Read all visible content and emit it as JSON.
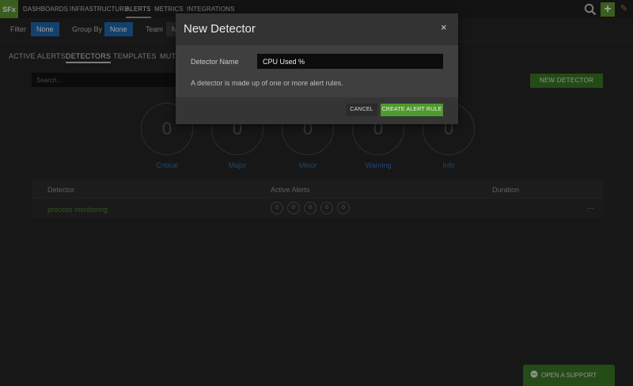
{
  "nav": {
    "logo": "SFx",
    "items": [
      {
        "label": "DASHBOARDS"
      },
      {
        "label": "INFRASTRUCTURE"
      },
      {
        "label": "ALERTS"
      },
      {
        "label": "METRICS"
      },
      {
        "label": "INTEGRATIONS"
      }
    ],
    "active": "ALERTS",
    "search_icon": "search-icon",
    "add_icon": "plus-icon",
    "user_icon": "user-icon"
  },
  "filters": {
    "filter_label": "Filter",
    "filter_value": "None",
    "group_by_label": "Group By",
    "group_by_value": "None",
    "team_label": "Team",
    "team_value": "N"
  },
  "tabs": [
    {
      "label": "ACTIVE ALERTS"
    },
    {
      "label": "DETECTORS"
    },
    {
      "label": "TEMPLATES"
    },
    {
      "label": "MUTI"
    }
  ],
  "active_tab": "DETECTORS",
  "search": {
    "placeholder": "Search..."
  },
  "new_detector_label": "NEW DETECTOR",
  "severities": [
    {
      "label": "Critical",
      "count": "0"
    },
    {
      "label": "Major",
      "count": "0"
    },
    {
      "label": "Minor",
      "count": "0"
    },
    {
      "label": "Warning",
      "count": "0"
    },
    {
      "label": "Info",
      "count": "0"
    }
  ],
  "table": {
    "headers": [
      "Detector",
      "Active Alerts",
      "Duration"
    ],
    "rows": [
      {
        "name": "process monitoring",
        "alerts": [
          "0",
          "0",
          "0",
          "0",
          "0"
        ],
        "menu": "..."
      }
    ]
  },
  "modal": {
    "title": "New Detector",
    "close": "×",
    "field_label": "Detector Name",
    "field_value": "CPU Used %",
    "help": "A detector is made up of one or more alert rules.",
    "cancel": "CANCEL",
    "create": "CREATE ALERT RULE"
  },
  "support": {
    "label": "OPEN A SUPPORT TICKET",
    "icon": "chat-icon"
  },
  "colors": {
    "accent_green": "#4e9a2f",
    "accent_blue": "#1d6ab0",
    "severity_label": "#2a75b8",
    "background": "#262626"
  }
}
